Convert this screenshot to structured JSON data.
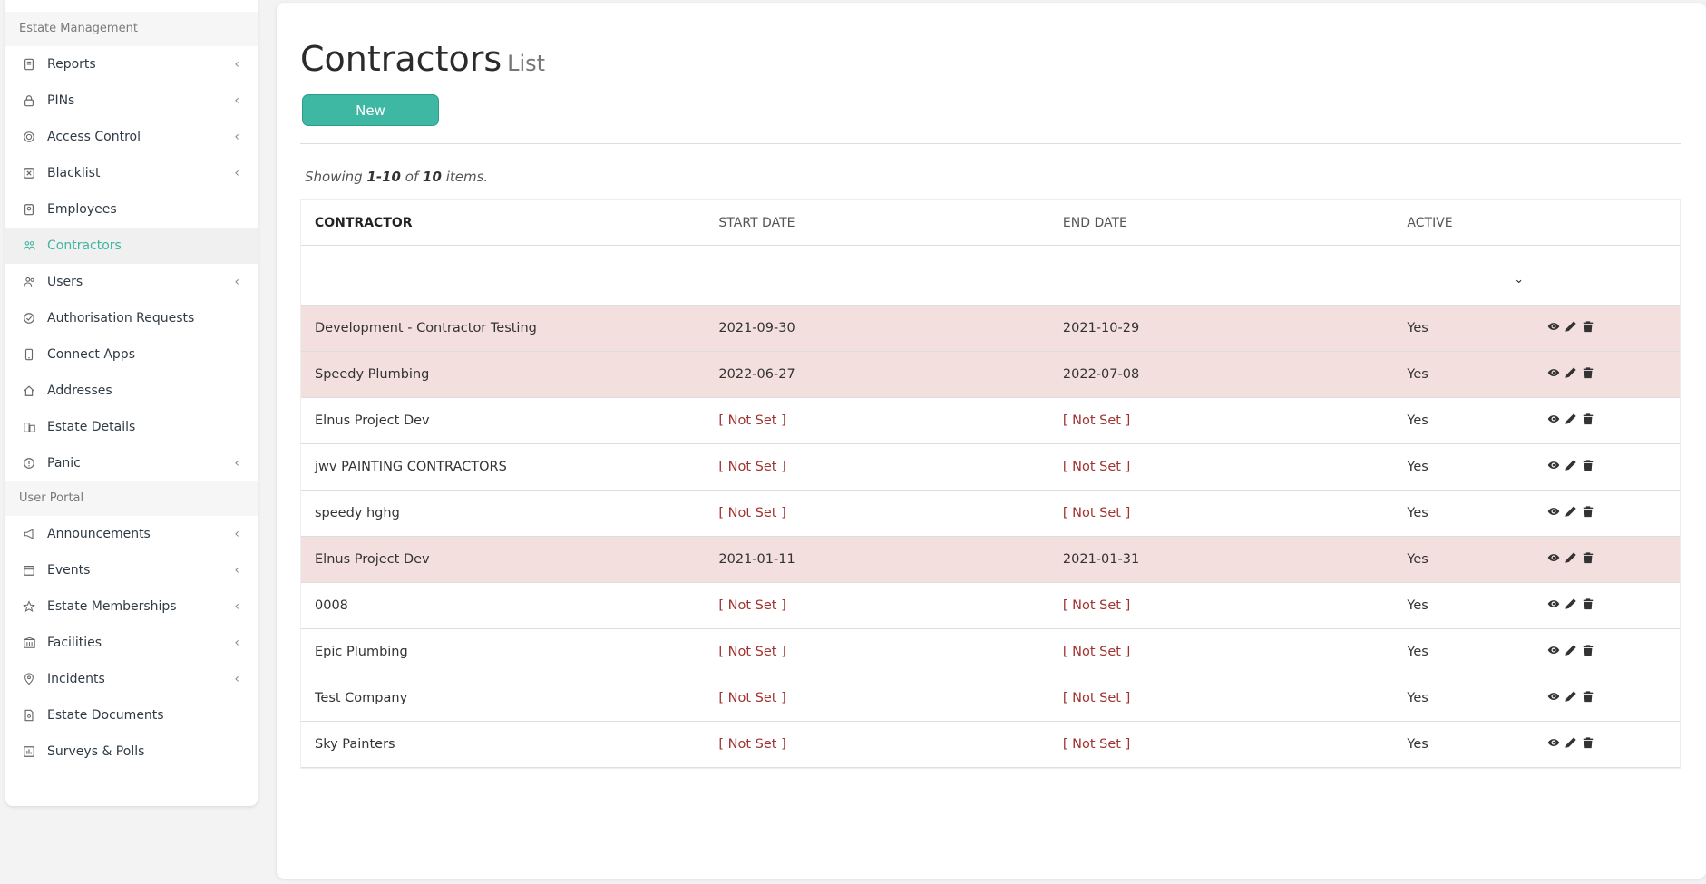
{
  "sidebar": {
    "section1": "Estate Management",
    "items1": [
      {
        "label": "Reports",
        "chevron": true
      },
      {
        "label": "PINs",
        "chevron": true
      },
      {
        "label": "Access Control",
        "chevron": true
      },
      {
        "label": "Blacklist",
        "chevron": true
      },
      {
        "label": "Employees",
        "chevron": false
      },
      {
        "label": "Contractors",
        "chevron": false,
        "active": true
      },
      {
        "label": "Users",
        "chevron": true
      },
      {
        "label": "Authorisation Requests",
        "chevron": false
      },
      {
        "label": "Connect Apps",
        "chevron": false
      },
      {
        "label": "Addresses",
        "chevron": false
      },
      {
        "label": "Estate Details",
        "chevron": false
      },
      {
        "label": "Panic",
        "chevron": true
      }
    ],
    "section2": "User Portal",
    "items2": [
      {
        "label": "Announcements",
        "chevron": true
      },
      {
        "label": "Events",
        "chevron": true
      },
      {
        "label": "Estate Memberships",
        "chevron": true
      },
      {
        "label": "Facilities",
        "chevron": true
      },
      {
        "label": "Incidents",
        "chevron": true
      },
      {
        "label": "Estate Documents",
        "chevron": false
      },
      {
        "label": "Surveys & Polls",
        "chevron": false
      }
    ]
  },
  "page": {
    "title": "Contractors",
    "subtitle": "List",
    "new_button": "New",
    "summary": {
      "prefix": "Showing",
      "range": "1-10",
      "of": "of",
      "total": "10",
      "suffix": "items."
    }
  },
  "table": {
    "headers": [
      "CONTRACTOR",
      "START DATE",
      "END DATE",
      "ACTIVE"
    ],
    "rows": [
      {
        "contractor": "Development - Contractor Testing",
        "start": "2021-09-30",
        "end": "2021-10-29",
        "active": "Yes",
        "flag": true
      },
      {
        "contractor": "Speedy Plumbing",
        "start": "2022-06-27",
        "end": "2022-07-08",
        "active": "Yes",
        "flag": true
      },
      {
        "contractor": "Elnus Project Dev",
        "start": "[ Not Set ]",
        "end": "[ Not Set ]",
        "active": "Yes",
        "flag": false
      },
      {
        "contractor": "jwv PAINTING CONTRACTORS",
        "start": "[ Not Set ]",
        "end": "[ Not Set ]",
        "active": "Yes",
        "flag": false
      },
      {
        "contractor": "speedy hghg",
        "start": "[ Not Set ]",
        "end": "[ Not Set ]",
        "active": "Yes",
        "flag": false
      },
      {
        "contractor": "Elnus Project Dev",
        "start": "2021-01-11",
        "end": "2021-01-31",
        "active": "Yes",
        "flag": true
      },
      {
        "contractor": "0008",
        "start": "[ Not Set ]",
        "end": "[ Not Set ]",
        "active": "Yes",
        "flag": false
      },
      {
        "contractor": "Epic Plumbing",
        "start": "[ Not Set ]",
        "end": "[ Not Set ]",
        "active": "Yes",
        "flag": false
      },
      {
        "contractor": "Test Company",
        "start": "[ Not Set ]",
        "end": "[ Not Set ]",
        "active": "Yes",
        "flag": false
      },
      {
        "contractor": "Sky Painters",
        "start": "[ Not Set ]",
        "end": "[ Not Set ]",
        "active": "Yes",
        "flag": false
      }
    ]
  },
  "colors": {
    "accent": "#3fb8a3",
    "flag_row": "#f4dfdf",
    "not_set": "#a0322f"
  },
  "icons": {
    "view": "eye-icon",
    "edit": "pencil-icon",
    "delete": "trash-icon"
  }
}
